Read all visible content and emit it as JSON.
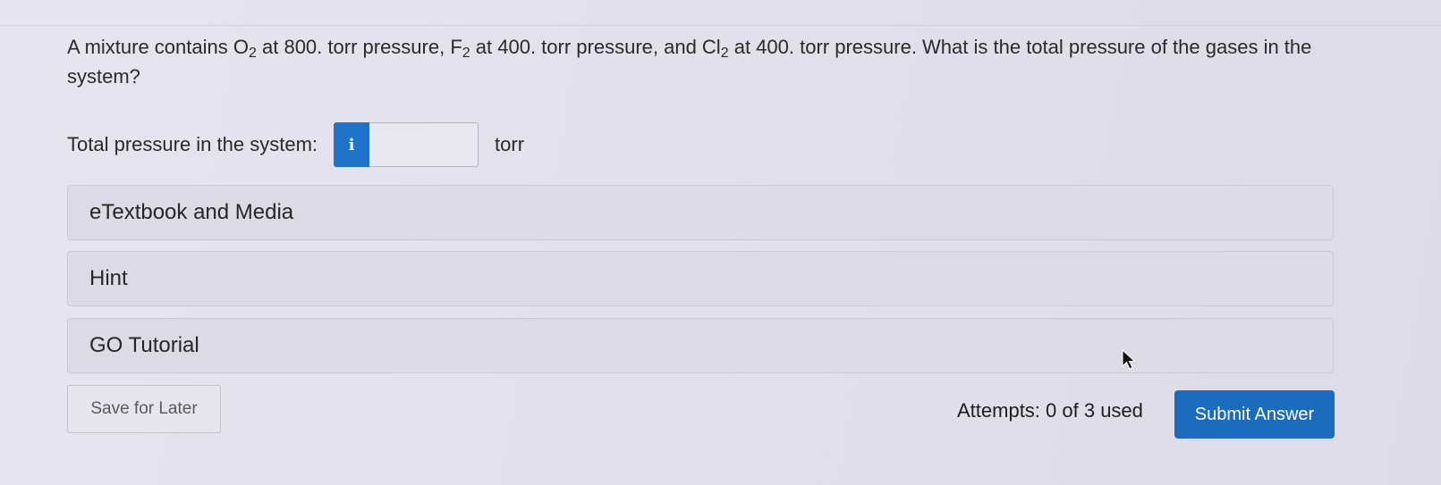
{
  "question": {
    "part1": "A mixture contains O",
    "sub1": "2",
    "part2": " at 800. torr pressure, F",
    "sub2": "2",
    "part3": " at 400. torr pressure, and Cl",
    "sub3": "2",
    "part4": " at 400. torr pressure. What is the total pressure of the gases in the system?"
  },
  "answer": {
    "label": "Total pressure in the system:",
    "info_icon": "i",
    "value": "",
    "unit": "torr"
  },
  "panels": [
    {
      "label": "eTextbook and Media"
    },
    {
      "label": "Hint"
    },
    {
      "label": "GO Tutorial"
    }
  ],
  "footer": {
    "save_label": "Save for Later",
    "attempts_text": "Attempts: 0 of 3 used",
    "submit_label": "Submit Answer"
  },
  "colors": {
    "accent": "#1b6bbf",
    "info_badge": "#1f73c9",
    "background": "#e3e1ec"
  },
  "icons": {
    "info": "info-icon",
    "cursor": "mouse-pointer-icon"
  }
}
